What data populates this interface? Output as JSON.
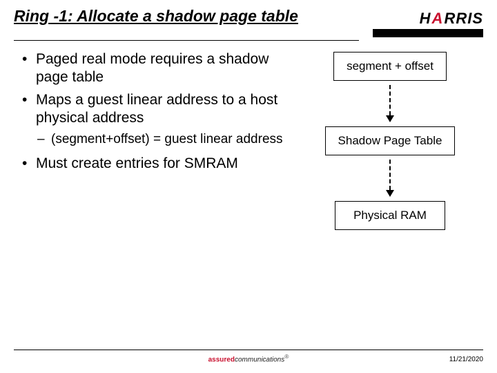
{
  "header": {
    "title": "Ring -1: Allocate a shadow page table",
    "logo_text_left": "H",
    "logo_text_right": "RRIS",
    "logo_slash": "A"
  },
  "bullets": {
    "b1": "Paged real mode requires a shadow page table",
    "b2": "Maps a guest linear address to a host physical address",
    "b2_sub": "(segment+offset) = guest linear address",
    "b3": "Must create entries for SMRAM"
  },
  "diagram": {
    "box1": "segment + offset",
    "box2": "Shadow Page Table",
    "box3": "Physical RAM"
  },
  "footer": {
    "brand_left": "assured",
    "brand_right": "communications",
    "date": "11/21/2020"
  }
}
